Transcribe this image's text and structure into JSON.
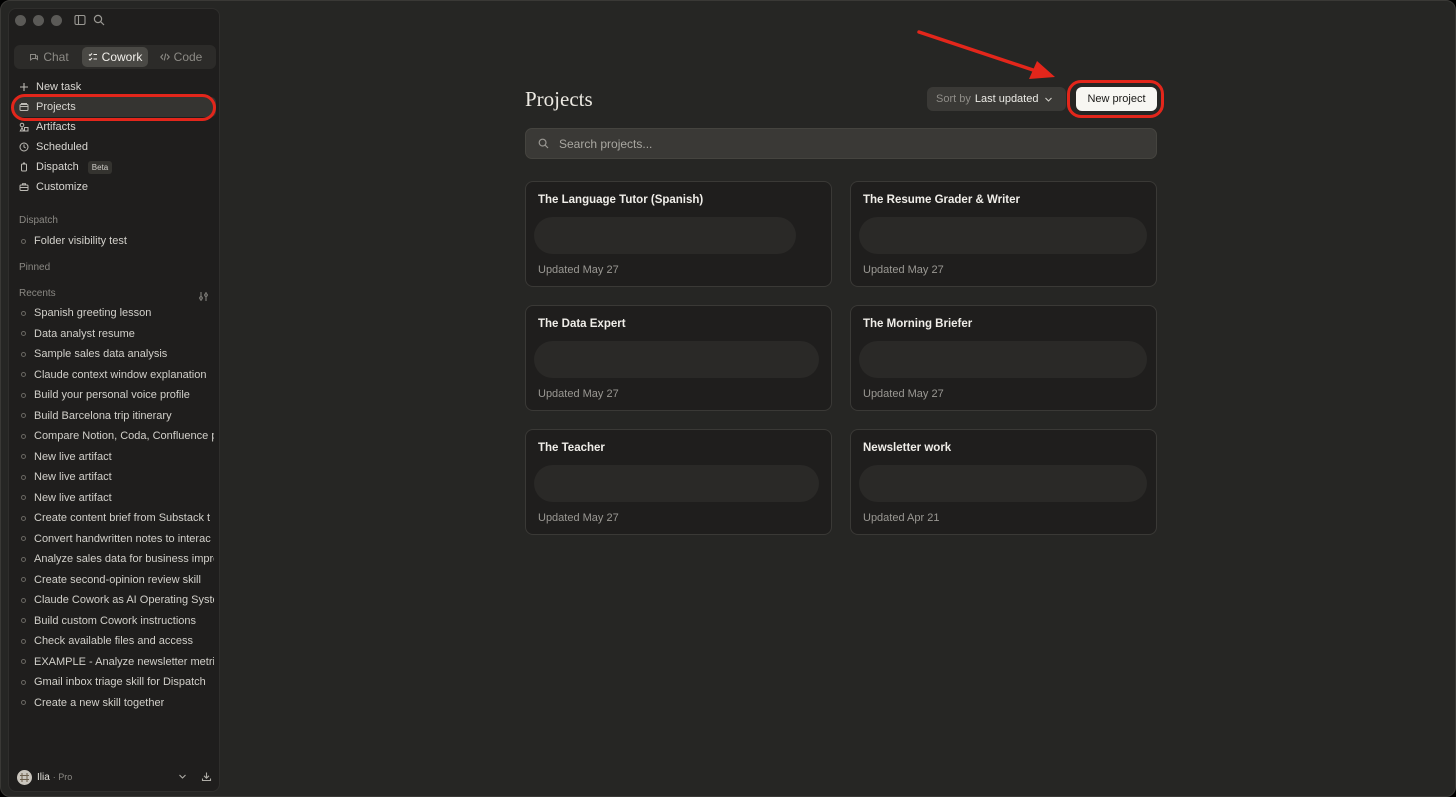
{
  "mode_tabs": [
    {
      "label": "Chat",
      "icon": "chat-icon",
      "active": false
    },
    {
      "label": "Cowork",
      "icon": "cowork-icon",
      "active": true
    },
    {
      "label": "Code",
      "icon": "code-icon",
      "active": false
    }
  ],
  "nav": [
    {
      "label": "New task",
      "icon": "plus-icon"
    },
    {
      "label": "Projects",
      "icon": "folder-icon",
      "active": true
    },
    {
      "label": "Artifacts",
      "icon": "artifacts-icon"
    },
    {
      "label": "Scheduled",
      "icon": "clock-icon"
    },
    {
      "label": "Dispatch",
      "icon": "dispatch-icon",
      "badge": "Beta"
    },
    {
      "label": "Customize",
      "icon": "briefcase-icon"
    }
  ],
  "sections": {
    "dispatch": "Dispatch",
    "pinned": "Pinned",
    "recents": "Recents"
  },
  "dispatch_items": [
    "Folder visibility test"
  ],
  "recents": [
    "Spanish greeting lesson",
    "Data analyst resume",
    "Sample sales data analysis",
    "Claude context window explanation",
    "Build your personal voice profile",
    "Build Barcelona trip itinerary",
    "Compare Notion, Coda, Confluence p",
    "New live artifact",
    "New live artifact",
    "New live artifact",
    "Create content brief from Substack t",
    "Convert handwritten notes to interac",
    "Analyze sales data for business impro",
    "Create second-opinion review skill",
    "Claude Cowork as AI Operating Syste",
    "Build custom Cowork instructions",
    "Check available files and access",
    "EXAMPLE - Analyze newsletter metri",
    "Gmail inbox triage skill for Dispatch",
    "Create a new skill together"
  ],
  "user": {
    "name": "Ilia",
    "plan": "· Pro"
  },
  "main": {
    "title": "Projects",
    "sort_label": "Sort by",
    "sort_value": "Last updated",
    "new_project_label": "New project",
    "search_placeholder": "Search projects..."
  },
  "projects": [
    {
      "title": "The Language Tutor (Spanish)",
      "updated": "Updated May 27"
    },
    {
      "title": "The Resume Grader & Writer",
      "updated": "Updated May 27"
    },
    {
      "title": "The Data Expert",
      "updated": "Updated May 27"
    },
    {
      "title": "The Morning Briefer",
      "updated": "Updated May 27"
    },
    {
      "title": "The Teacher",
      "updated": "Updated May 27"
    },
    {
      "title": "Newsletter work",
      "updated": "Updated Apr 21"
    }
  ],
  "colors": {
    "annotation": "#e3261b",
    "background": "#262624",
    "sidebar": "#1f1e1d"
  }
}
